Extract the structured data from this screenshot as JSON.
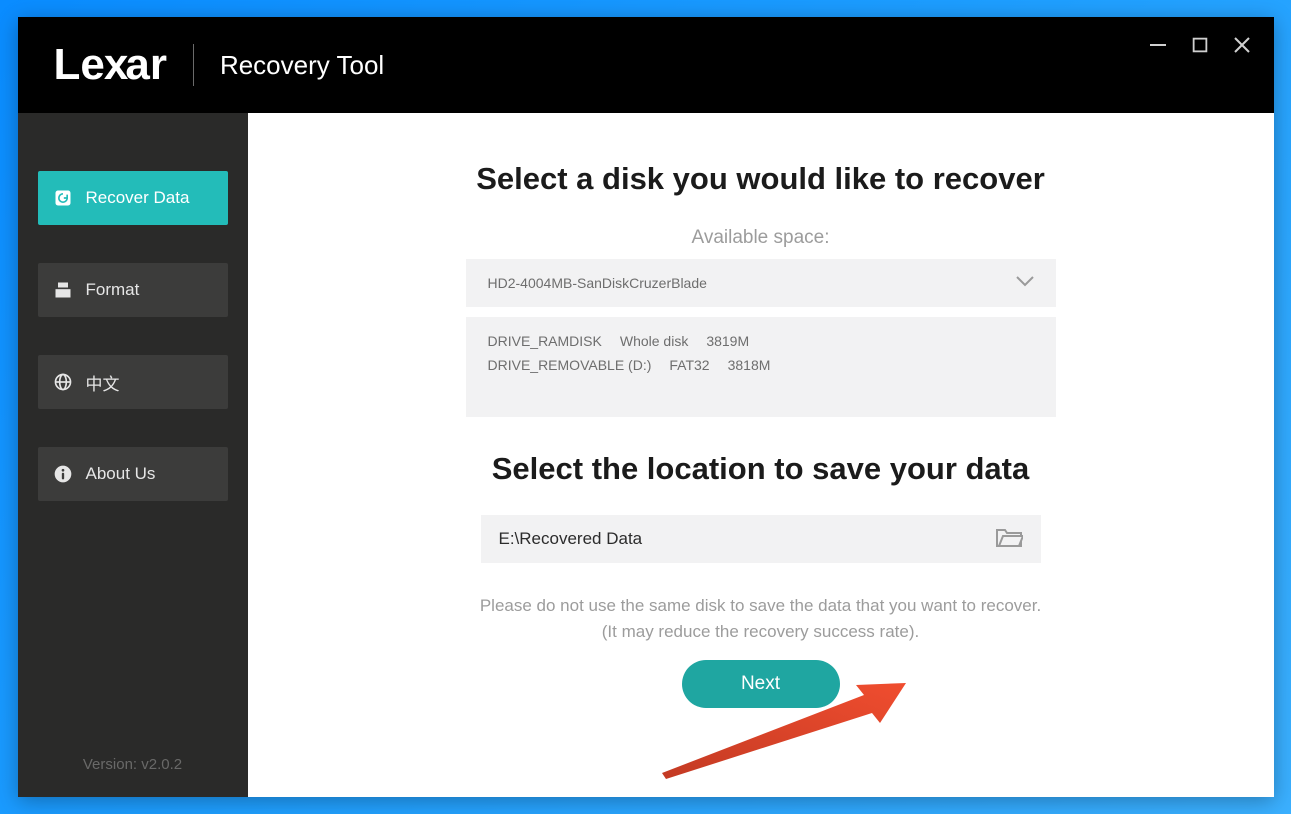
{
  "header": {
    "brand": "Lexar",
    "app_title": "Recovery Tool"
  },
  "sidebar": {
    "items": [
      {
        "label": "Recover Data",
        "icon": "recover-icon",
        "active": true
      },
      {
        "label": "Format",
        "icon": "format-icon",
        "active": false
      },
      {
        "label": "中文",
        "icon": "globe-icon",
        "active": false
      },
      {
        "label": "About Us",
        "icon": "info-icon",
        "active": false
      }
    ],
    "version": "Version: v2.0.2"
  },
  "main": {
    "select_disk_heading": "Select a disk you would like to recover",
    "available_space_label": "Available space:",
    "disk_dropdown": {
      "selected": "HD2-4004MB-SanDiskCruzerBlade",
      "options": [
        {
          "name": "DRIVE_RAMDISK",
          "desc": "Whole disk",
          "size": "3819M"
        },
        {
          "name": "DRIVE_REMOVABLE (D:)",
          "desc": "FAT32",
          "size": "3818M"
        }
      ]
    },
    "select_location_heading": "Select the location to save your data",
    "save_path": "E:\\Recovered Data",
    "warning_line1": "Please do not use the same disk to save the data that you want to recover.",
    "warning_line2": "(It may reduce the recovery success rate).",
    "next_button": "Next"
  }
}
